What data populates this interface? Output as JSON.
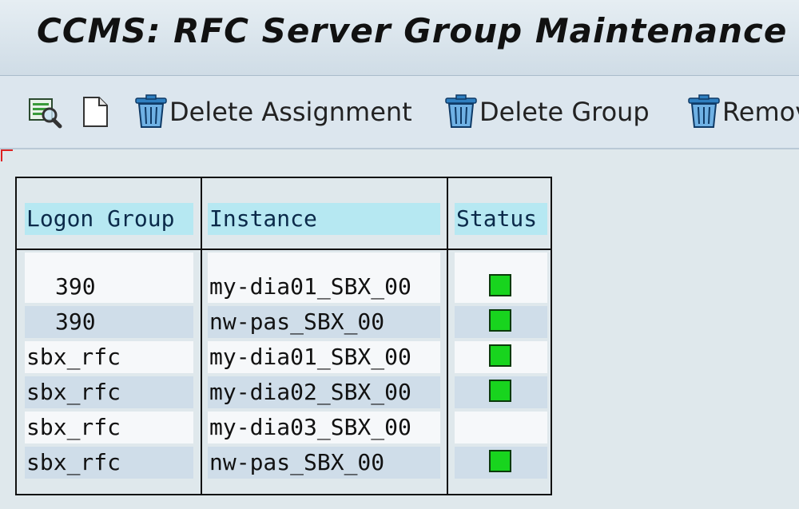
{
  "header": {
    "title": "CCMS: RFC Server Group Maintenance"
  },
  "toolbar": {
    "buttons": [
      {
        "icon": "display-icon",
        "label": ""
      },
      {
        "icon": "new-document-icon",
        "label": ""
      },
      {
        "icon": "trash-icon",
        "label": "Delete Assignment"
      },
      {
        "icon": "trash-icon",
        "label": "Delete Group"
      },
      {
        "icon": "trash-icon",
        "label": "Remov"
      }
    ]
  },
  "table": {
    "columns": [
      "Logon Group",
      "Instance",
      "Status"
    ],
    "rows": [
      {
        "group": "390",
        "instance": "my-dia01_SBX_00",
        "status": "green"
      },
      {
        "group": "390",
        "instance": "nw-pas_SBX_00",
        "status": "green"
      },
      {
        "group": "sbx_rfc",
        "instance": "my-dia01_SBX_00",
        "status": "green"
      },
      {
        "group": "sbx_rfc",
        "instance": "my-dia02_SBX_00",
        "status": "green"
      },
      {
        "group": "sbx_rfc",
        "instance": "my-dia03_SBX_00",
        "status": ""
      },
      {
        "group": "sbx_rfc",
        "instance": "nw-pas_SBX_00",
        "status": "green"
      }
    ]
  },
  "colors": {
    "status_green": "#18d41e",
    "header_bg": "#b6e8f2",
    "row_alt": "#cfdde9"
  }
}
